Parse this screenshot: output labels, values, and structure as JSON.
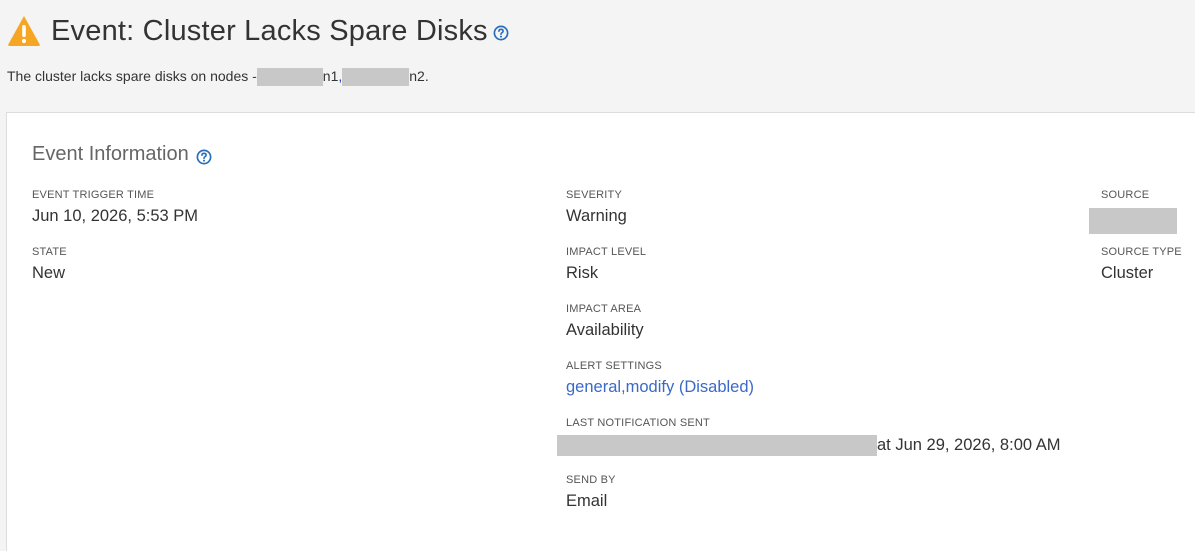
{
  "header": {
    "title": "Event: Cluster Lacks Spare Disks",
    "description_prefix": "The cluster lacks spare disks on nodes ",
    "node1_suffix": "n1",
    "separator": ",",
    "node2_suffix": "n2",
    "description_end": "."
  },
  "event_information": {
    "title": "Event Information",
    "trigger_time": {
      "label": "EVENT TRIGGER TIME",
      "value": "Jun 10, 2026, 5:53 PM"
    },
    "state": {
      "label": "STATE",
      "value": "New"
    },
    "severity": {
      "label": "SEVERITY",
      "value": "Warning"
    },
    "impact_level": {
      "label": "IMPACT LEVEL",
      "value": "Risk"
    },
    "impact_area": {
      "label": "IMPACT AREA",
      "value": "Availability"
    },
    "alert_settings": {
      "label": "ALERT SETTINGS",
      "general": "general",
      "separator": ",",
      "modify": "modify (Disabled)"
    },
    "last_notification": {
      "label": "LAST NOTIFICATION SENT",
      "value_suffix": "at Jun 29, 2026, 8:00 AM"
    },
    "send_by": {
      "label": "SEND BY",
      "value": "Email"
    },
    "source": {
      "label": "SOURCE"
    },
    "source_type": {
      "label": "SOURCE TYPE",
      "value": "Cluster"
    }
  },
  "colors": {
    "warning": "#f5a623",
    "help": "#2a6ebb",
    "link": "#3b69c8",
    "redaction": "#c8c8c8"
  },
  "icons": [
    "warning-triangle-icon",
    "help-circle-icon"
  ]
}
